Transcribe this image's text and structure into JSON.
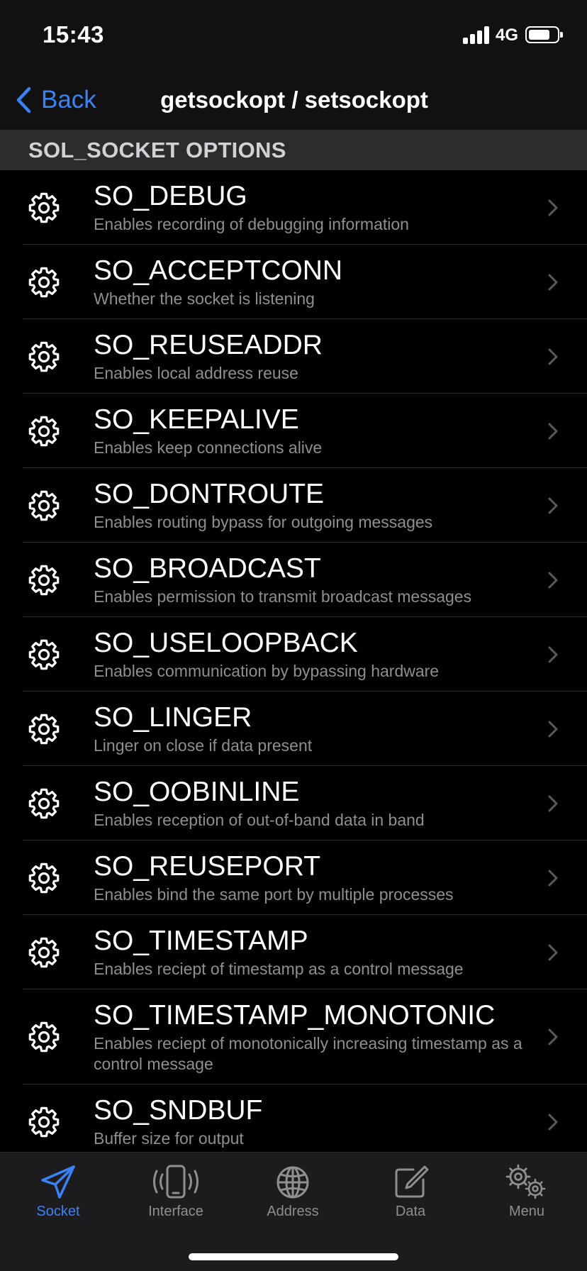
{
  "status_bar": {
    "time": "15:43",
    "network": "4G",
    "battery_level": 0.75
  },
  "navbar": {
    "back_label": "Back",
    "title": "getsockopt / setsockopt"
  },
  "section": {
    "title": "SOL_SOCKET OPTIONS"
  },
  "options": [
    {
      "name": "SO_DEBUG",
      "description": "Enables recording of debugging information"
    },
    {
      "name": "SO_ACCEPTCONN",
      "description": "Whether the socket is listening"
    },
    {
      "name": "SO_REUSEADDR",
      "description": "Enables local address reuse"
    },
    {
      "name": "SO_KEEPALIVE",
      "description": "Enables keep connections alive"
    },
    {
      "name": "SO_DONTROUTE",
      "description": "Enables routing bypass for outgoing messages"
    },
    {
      "name": "SO_BROADCAST",
      "description": "Enables permission to transmit broadcast messages"
    },
    {
      "name": "SO_USELOOPBACK",
      "description": "Enables communication by bypassing hardware"
    },
    {
      "name": "SO_LINGER",
      "description": "Linger on close if data present"
    },
    {
      "name": "SO_OOBINLINE",
      "description": "Enables reception of out-of-band data in band"
    },
    {
      "name": "SO_REUSEPORT",
      "description": "Enables bind the same port by multiple processes"
    },
    {
      "name": "SO_TIMESTAMP",
      "description": "Enables reciept of timestamp as a control message"
    },
    {
      "name": "SO_TIMESTAMP_MONOTONIC",
      "description": "Enables reciept of monotonically increasing timestamp as a control message"
    },
    {
      "name": "SO_SNDBUF",
      "description": "Buffer size for output"
    }
  ],
  "tabs": [
    {
      "label": "Socket",
      "icon": "paper-plane-icon",
      "active": true
    },
    {
      "label": "Interface",
      "icon": "phone-vibrate-icon",
      "active": false
    },
    {
      "label": "Address",
      "icon": "globe-icon",
      "active": false
    },
    {
      "label": "Data",
      "icon": "edit-square-icon",
      "active": false
    },
    {
      "label": "Menu",
      "icon": "gears-icon",
      "active": false
    }
  ],
  "colors": {
    "accent": "#3a82f7",
    "background": "#000000",
    "bar_background": "#1c1c1e",
    "section_background": "#2c2c2e",
    "secondary_text": "#8e8e93"
  }
}
